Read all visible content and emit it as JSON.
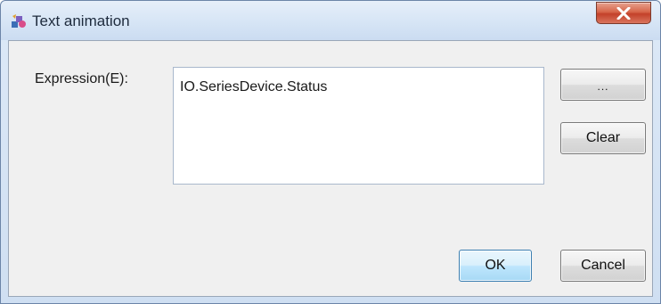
{
  "window": {
    "title": "Text animation",
    "app_icon": "text-animation-app-icon",
    "close_icon": "close-x-icon",
    "close_color": "#c8452d"
  },
  "form": {
    "expression_label": "Expression(E):",
    "expression_value": "IO.SeriesDevice.Status"
  },
  "buttons": {
    "browse_label": "...",
    "clear_label": "Clear",
    "ok_label": "OK",
    "cancel_label": "Cancel"
  }
}
